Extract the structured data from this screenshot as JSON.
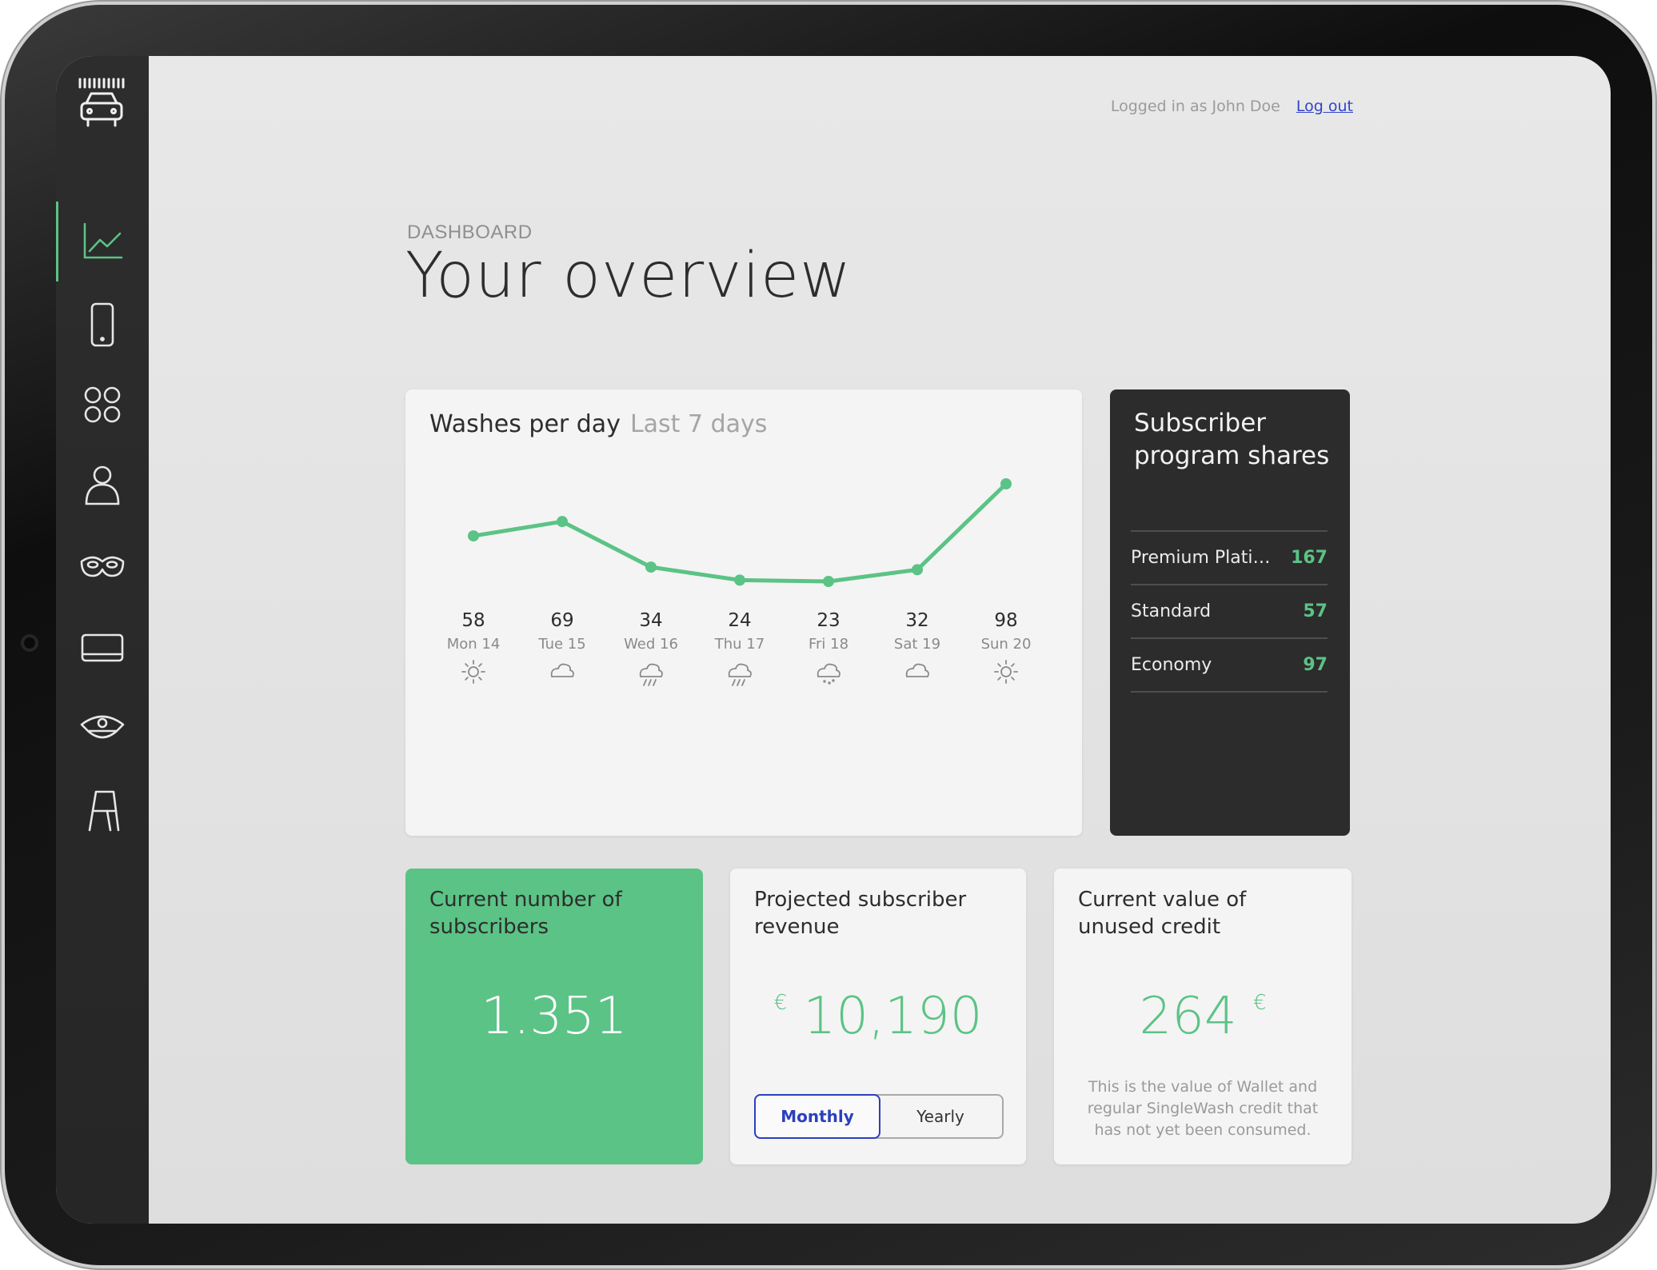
{
  "header": {
    "logged_in_text": "Logged in as John Doe",
    "logout_label": "Log out"
  },
  "page": {
    "eyebrow": "DASHBOARD",
    "title": "Your overview"
  },
  "nav": [
    "chart-icon",
    "phone-icon",
    "apps-icon",
    "user-icon",
    "mask-icon",
    "card-icon",
    "officer-cap-icon",
    "sign-icon"
  ],
  "chart_data": {
    "type": "line",
    "title": "Washes per day",
    "subtitle": "Last 7 days",
    "categories": [
      "Mon 14",
      "Tue 15",
      "Wed 16",
      "Thu 17",
      "Fri 18",
      "Sat 19",
      "Sun 20"
    ],
    "values": [
      58,
      69,
      34,
      24,
      23,
      32,
      98
    ],
    "weather": [
      "sun",
      "cloud",
      "rain",
      "rain",
      "drizzle",
      "cloud",
      "sun"
    ],
    "line_color": "#5bc385"
  },
  "shares": {
    "title": "Subscriber program shares",
    "items": [
      {
        "name": "Premium Platinu…",
        "value": "167"
      },
      {
        "name": "Standard",
        "value": "57"
      },
      {
        "name": "Economy",
        "value": "97"
      }
    ]
  },
  "stats": {
    "subscribers": {
      "label": "Current number of subscribers",
      "value": "1.351"
    },
    "revenue": {
      "label": "Projected subscriber revenue",
      "currency": "€",
      "value": "10,190",
      "toggle": [
        "Monthly",
        "Yearly"
      ],
      "selected": "Monthly"
    },
    "credit": {
      "label": "Current value of unused credit",
      "value": "264",
      "currency": "€",
      "note": "This is the value of Wallet and regular SingleWash credit that has not yet been consumed."
    }
  },
  "colors": {
    "accent": "#5bc385",
    "link": "#3245c8",
    "dark_card": "#2c2c2c"
  }
}
